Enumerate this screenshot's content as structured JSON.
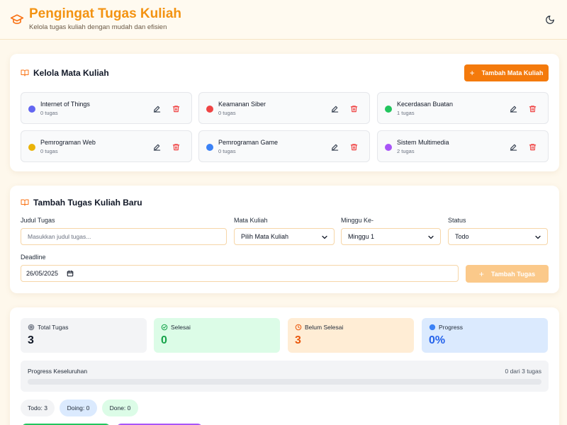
{
  "header": {
    "title": "Pengingat Tugas Kuliah",
    "subtitle": "Kelola tugas kuliah dengan mudah dan efisien",
    "logo_icon": "graduation-cap-icon",
    "theme_icon": "moon-icon"
  },
  "courses_section": {
    "title": "Kelola Mata Kuliah",
    "add_button": "Tambah Mata Kuliah",
    "courses": [
      {
        "name": "Internet of Things",
        "count": "0 tugas",
        "color": "#6366f1"
      },
      {
        "name": "Keamanan Siber",
        "count": "0 tugas",
        "color": "#ef4444"
      },
      {
        "name": "Kecerdasan Buatan",
        "count": "1 tugas",
        "color": "#22c55e"
      },
      {
        "name": "Pemrograman Web",
        "count": "0 tugas",
        "color": "#eab308"
      },
      {
        "name": "Pemrograman Game",
        "count": "0 tugas",
        "color": "#3b82f6"
      },
      {
        "name": "Sistem Multimedia",
        "count": "2 tugas",
        "color": "#a855f7"
      }
    ]
  },
  "task_form": {
    "title": "Tambah Tugas Kuliah Baru",
    "title_label": "Judul Tugas",
    "title_placeholder": "Masukkan judul tugas...",
    "course_label": "Mata Kuliah",
    "course_value": "Pilih Mata Kuliah",
    "week_label": "Minggu Ke-",
    "week_value": "Minggu 1",
    "status_label": "Status",
    "status_value": "Todo",
    "deadline_label": "Deadline",
    "deadline_value": "26/05/2025",
    "submit_button": "Tambah Tugas"
  },
  "stats": {
    "total": {
      "label": "Total Tugas",
      "value": "3",
      "color": "#111827",
      "bg": "#f3f4f6"
    },
    "done": {
      "label": "Selesai",
      "value": "0",
      "color": "#16a34a",
      "bg": "#dcfce7"
    },
    "pending": {
      "label": "Belum Selesai",
      "value": "3",
      "color": "#ea580c",
      "bg": "#ffedd5"
    },
    "progress": {
      "label": "Progress",
      "value": "0%",
      "color": "#2563eb",
      "bg": "#dbeafe"
    },
    "overall_label": "Progress Keseluruhan",
    "overall_count": "0 dari 3 tugas",
    "overall_fraction": 0,
    "status_pills": [
      {
        "label": "Todo: 3",
        "bg": "#f3f4f6"
      },
      {
        "label": "Doing: 0",
        "bg": "#dbeafe"
      },
      {
        "label": "Done: 0",
        "bg": "#dcfce7"
      }
    ]
  }
}
